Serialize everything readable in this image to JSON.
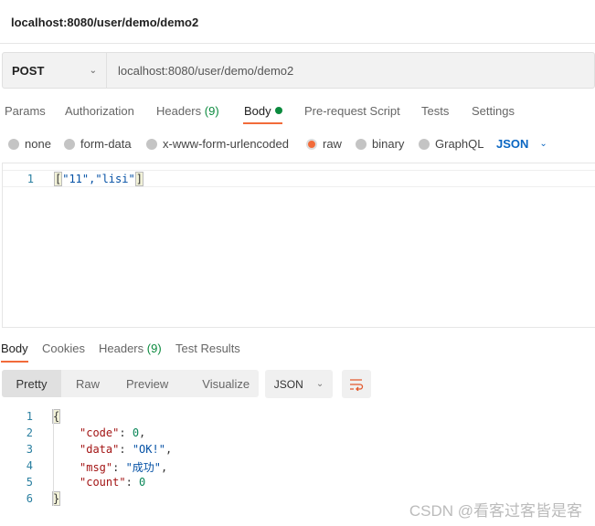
{
  "window": {
    "title": "localhost:8080/user/demo/demo2"
  },
  "request": {
    "method": "POST",
    "url": "localhost:8080/user/demo/demo2"
  },
  "request_tabs": [
    {
      "label": "Params"
    },
    {
      "label": "Authorization"
    },
    {
      "label": "Headers",
      "count": "(9)"
    },
    {
      "label": "Body",
      "active": true
    },
    {
      "label": "Pre-request Script"
    },
    {
      "label": "Tests"
    },
    {
      "label": "Settings"
    }
  ],
  "body_types": [
    {
      "label": "none"
    },
    {
      "label": "form-data"
    },
    {
      "label": "x-www-form-urlencoded"
    },
    {
      "label": "raw",
      "selected": true
    },
    {
      "label": "binary"
    },
    {
      "label": "GraphQL"
    }
  ],
  "body_format": "JSON",
  "request_body": {
    "line": "1",
    "prefix": "[",
    "content": "\"11\",\"lisi\"",
    "suffix": "]"
  },
  "response_tabs": [
    {
      "label": "Body",
      "active": true
    },
    {
      "label": "Cookies"
    },
    {
      "label": "Headers",
      "count": "(9)"
    },
    {
      "label": "Test Results"
    }
  ],
  "view_modes": [
    "Pretty",
    "Raw",
    "Preview",
    "Visualize"
  ],
  "response_format": "JSON",
  "response_lines": [
    {
      "n": "1",
      "open": "{"
    },
    {
      "n": "2",
      "key": "\"code\"",
      "val": "0",
      "type": "n",
      "comma": ","
    },
    {
      "n": "3",
      "key": "\"data\"",
      "val": "\"OK!\"",
      "type": "s",
      "comma": ","
    },
    {
      "n": "4",
      "key": "\"msg\"",
      "val": "\"成功\"",
      "type": "s",
      "comma": ","
    },
    {
      "n": "5",
      "key": "\"count\"",
      "val": "0",
      "type": "n",
      "comma": ""
    },
    {
      "n": "6",
      "open": "}"
    }
  ],
  "watermark": "CSDN @看客过客皆是客",
  "colors": {
    "accent": "#f26b3a",
    "green": "#0b8a3e",
    "link": "#0a66c2"
  }
}
